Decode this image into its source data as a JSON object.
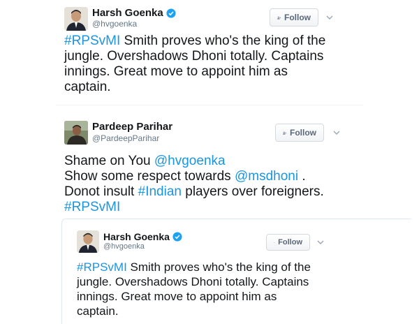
{
  "tweet1": {
    "name": "Harsh Goenka",
    "handle": "@hvgoenka",
    "follow_label": "Follow",
    "lines": [
      [
        {
          "t": "#RPSvMI",
          "c": "tag"
        },
        {
          "t": " Smith proves who's the king of the",
          "c": "text"
        }
      ],
      [
        {
          "t": "jungle. Overshadows Dhoni totally. Captains",
          "c": "text"
        }
      ],
      [
        {
          "t": "innings. Great move to appoint him as",
          "c": "text"
        }
      ],
      [
        {
          "t": "captain.",
          "c": "text"
        }
      ]
    ]
  },
  "tweet2": {
    "name": "Pardeep Parihar",
    "handle": "@PardeepParihar",
    "follow_label": "Follow",
    "lines": [
      [
        {
          "t": "Shame on You ",
          "c": "text"
        },
        {
          "t": "@hvgoenka",
          "c": "mention"
        }
      ],
      [
        {
          "t": "Show some respect towards ",
          "c": "text"
        },
        {
          "t": "@msdhoni",
          "c": "mention"
        },
        {
          "t": " .",
          "c": "text"
        }
      ],
      [
        {
          "t": "Donot insult ",
          "c": "text"
        },
        {
          "t": "#Indian",
          "c": "tag"
        },
        {
          "t": " players over foreigners.",
          "c": "text"
        }
      ],
      [
        {
          "t": "#RPSvMI",
          "c": "tag"
        }
      ]
    ]
  },
  "quoted": {
    "name": "Harsh Goenka",
    "handle": "@hvgoenka",
    "follow_label": "Follow",
    "lines": [
      [
        {
          "t": "#RPSvMI",
          "c": "tag"
        },
        {
          "t": " Smith proves who's the king of the",
          "c": "text"
        }
      ],
      [
        {
          "t": "jungle. Overshadows Dhoni totally. Captains",
          "c": "text"
        }
      ],
      [
        {
          "t": "innings. Great move to appoint him as",
          "c": "text"
        }
      ],
      [
        {
          "t": "captain.",
          "c": "text"
        }
      ]
    ]
  },
  "colors": {
    "link": "#1b95e0",
    "verified": "#1da1f2",
    "muted": "#657786"
  },
  "icons": {
    "verified": "verified-badge-icon",
    "follow": "add-user-icon",
    "caret": "chevron-down-icon"
  }
}
